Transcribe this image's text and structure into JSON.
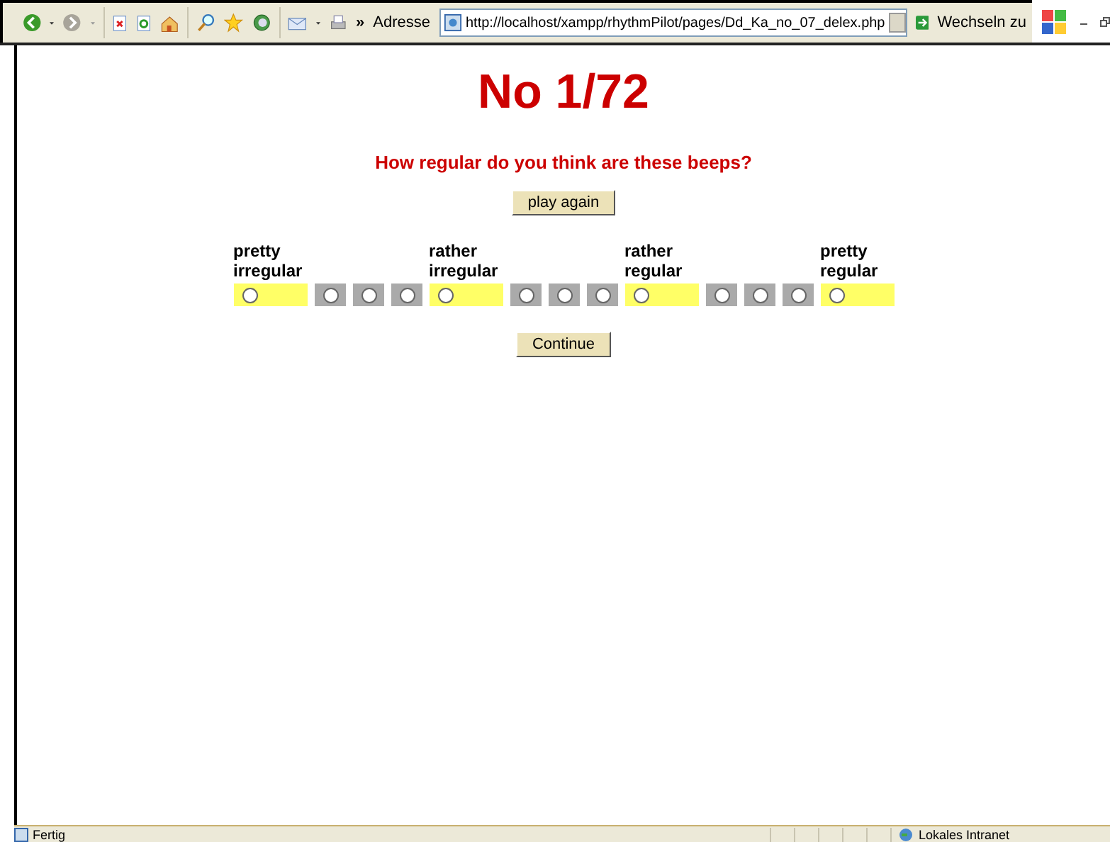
{
  "toolbar": {
    "address_label": "Adresse",
    "url": "http://localhost/xampp/rhythmPilot/pages/Dd_Ka_no_07_delex.php",
    "go_label": "Wechseln zu",
    "overflow": "»"
  },
  "page": {
    "title": "No 1/72",
    "question": "How regular do you think are these beeps?",
    "play_button": "play again",
    "continue_button": "Continue",
    "options": [
      {
        "kind": "anchor",
        "label": "pretty irregular",
        "selected": false
      },
      {
        "kind": "step",
        "selected": false
      },
      {
        "kind": "step",
        "selected": false
      },
      {
        "kind": "step",
        "selected": false
      },
      {
        "kind": "anchor",
        "label": "rather irregular",
        "selected": false
      },
      {
        "kind": "step",
        "selected": false
      },
      {
        "kind": "step",
        "selected": false
      },
      {
        "kind": "step",
        "selected": false
      },
      {
        "kind": "anchor",
        "label": "rather regular",
        "selected": false
      },
      {
        "kind": "step",
        "selected": false
      },
      {
        "kind": "step",
        "selected": false
      },
      {
        "kind": "step",
        "selected": false
      },
      {
        "kind": "anchor",
        "label": "pretty regular",
        "selected": false
      }
    ]
  },
  "status_bar": {
    "text": "Fertig",
    "zone": "Lokales Intranet"
  }
}
